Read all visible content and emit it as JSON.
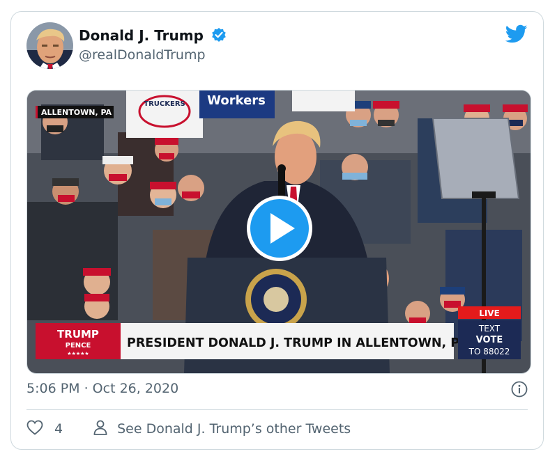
{
  "tweet": {
    "author_name": "Donald J. Trump",
    "handle": "@realDonaldTrump",
    "timestamp": "5:06 PM · Oct 26, 2020",
    "like_count": "4",
    "other_tweets_label": "See Donald J. Trump’s other Tweets"
  },
  "video": {
    "location_tag": "ALLENTOWN, PA",
    "sign_1": "Workers",
    "sign_2": "TRUCKERS",
    "live_label": "LIVE",
    "lower_third_headline": "PRESIDENT DONALD J. TRUMP IN ALLENTOWN, PA",
    "brand_top": "TRUMP",
    "brand_bottom": "PENCE",
    "brand_stars": "★★★★★",
    "text_line1": "TEXT",
    "text_line2": "VOTE",
    "text_line3": "TO 88022"
  },
  "icons": {
    "verified": "verified-badge-icon",
    "logo": "twitter-bird-icon",
    "info": "info-icon",
    "like": "heart-icon",
    "profile": "person-icon",
    "play": "play-icon"
  },
  "colors": {
    "twitter_blue": "#1d9bf0",
    "text_primary": "#0f1419",
    "text_secondary": "#536471",
    "border": "#cfd9de",
    "campaign_red": "#c8102e",
    "campaign_navy": "#1c2a55"
  }
}
